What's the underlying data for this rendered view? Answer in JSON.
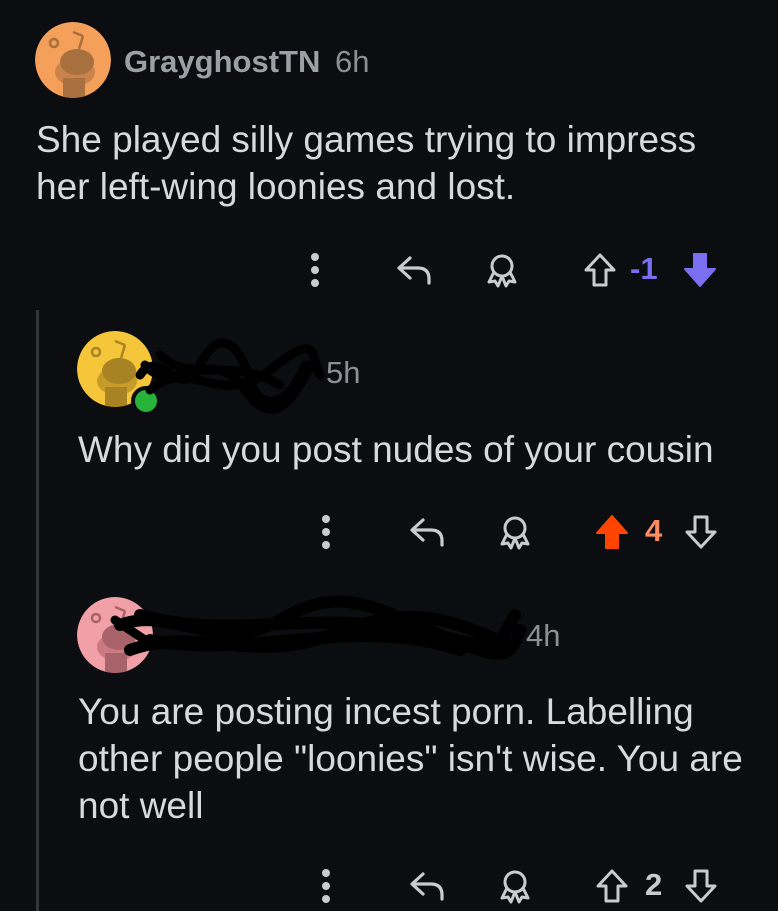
{
  "comments": [
    {
      "username": "GrayghostTN",
      "age": "6h",
      "text": "She played silly games trying to impress her left-wing loonies and lost.",
      "score": "-1",
      "vote_state": "downvoted",
      "avatar_color": "#f4a05a"
    },
    {
      "username": "",
      "age": "5h",
      "text": "Why did you post nudes of your cousin",
      "score": "4",
      "vote_state": "upvoted",
      "avatar_color": "#f5c53a"
    },
    {
      "username": "",
      "age": "4h",
      "text": "You are posting incest porn. Labelling other people \"loonies\" isn't wise. You are not well",
      "score": "2",
      "vote_state": "none",
      "avatar_color": "#f1a0a8"
    }
  ],
  "icons": {
    "more": "more-vertical-icon",
    "reply": "reply-icon",
    "award": "award-icon",
    "upvote": "upvote-icon",
    "downvote": "downvote-icon"
  },
  "colors": {
    "background": "#0b0d10",
    "downvote": "#7a6ff0",
    "upvote": "#ff4500",
    "upvote_score": "#ff8b60",
    "muted": "#8a9095",
    "text": "#d7dadc"
  }
}
